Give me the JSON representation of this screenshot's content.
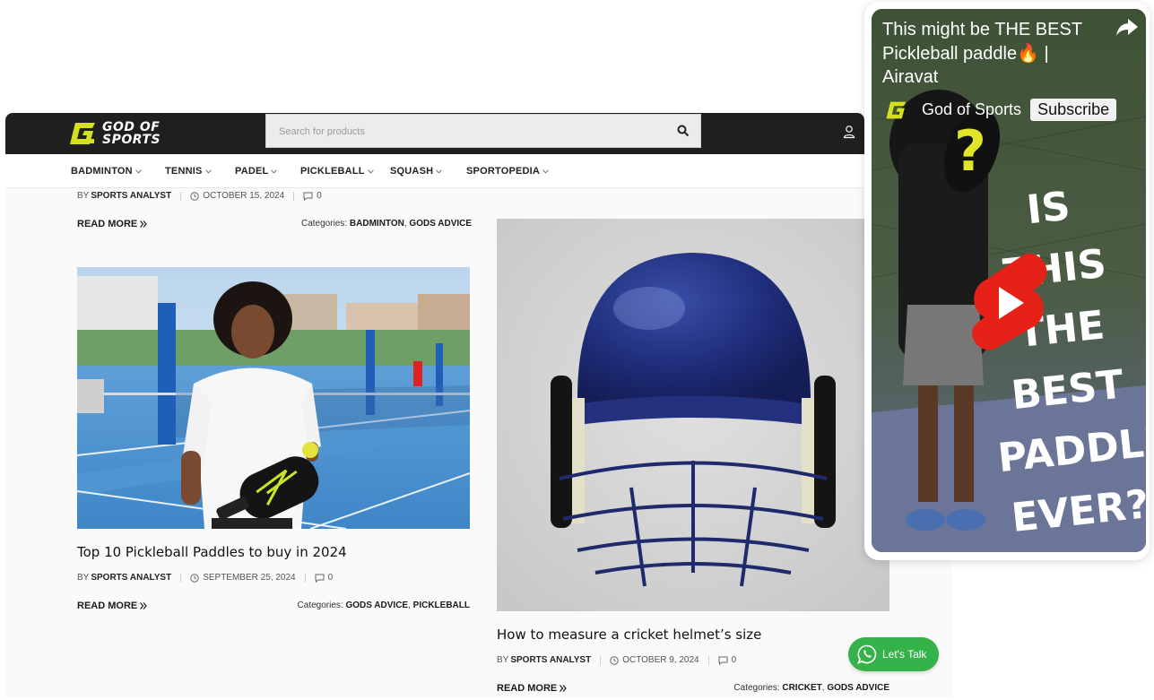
{
  "header": {
    "logo_line1": "GOD OF",
    "logo_line2": "SPORTS",
    "search_placeholder": "Search for products"
  },
  "nav": {
    "items": [
      {
        "label": "BADMINTON"
      },
      {
        "label": "TENNIS"
      },
      {
        "label": "PADEL"
      },
      {
        "label": "PICKLEBALL"
      },
      {
        "label": "SQUASH"
      },
      {
        "label": "SPORTOPEDIA"
      }
    ]
  },
  "posts": [
    {
      "by": "BY",
      "author": "SPORTS ANALYST",
      "date": "OCTOBER 15, 2024",
      "comments": "0",
      "read_more": "READ MORE",
      "categories_label": "Categories:",
      "categories": [
        "BADMINTON",
        "GODS ADVICE"
      ]
    },
    {
      "title": "Top 10 Pickleball Paddles to buy in 2024",
      "by": "BY",
      "author": "SPORTS ANALYST",
      "date": "SEPTEMBER 25, 2024",
      "comments": "0",
      "read_more": "READ MORE",
      "categories_label": "Categories:",
      "categories": [
        "GODS ADVICE",
        "PICKLEBALL"
      ]
    },
    {
      "title": "How to measure a cricket helmet’s size",
      "by": "BY",
      "author": "SPORTS ANALYST",
      "date": "OCTOBER 9, 2024",
      "comments": "0",
      "read_more": "READ MORE",
      "categories_label": "Categories:",
      "categories": [
        "CRICKET",
        "GODS ADVICE"
      ]
    }
  ],
  "separators": {
    "comma": ","
  },
  "video": {
    "title": "This might be THE BEST Pickleball paddle🔥 | Airavat",
    "channel": "God of Sports",
    "subscribe": "Subscribe",
    "overlay_line1": "IS THIS",
    "overlay_line2": "THE",
    "overlay_line3": "BEST",
    "overlay_line4": "PADDLE",
    "overlay_line5": "EVER?"
  },
  "whatsapp": {
    "label": "Let's Talk"
  },
  "colors": {
    "brand_yellow": "#d4e021",
    "header_dark": "#1f1f1f",
    "whatsapp_green": "#36b24a",
    "youtube_red": "#e62117"
  }
}
